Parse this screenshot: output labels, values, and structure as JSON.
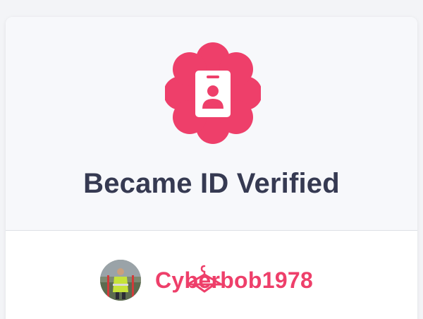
{
  "badge": {
    "title": "Became ID Verified",
    "icon": "id-card-icon",
    "accent_color": "#ee3f6a"
  },
  "user": {
    "username": "Cyberbob1978",
    "avatar": "user-avatar-photo",
    "overlay_icon": "hanger-icon",
    "name_color": "#ee3f6a"
  }
}
